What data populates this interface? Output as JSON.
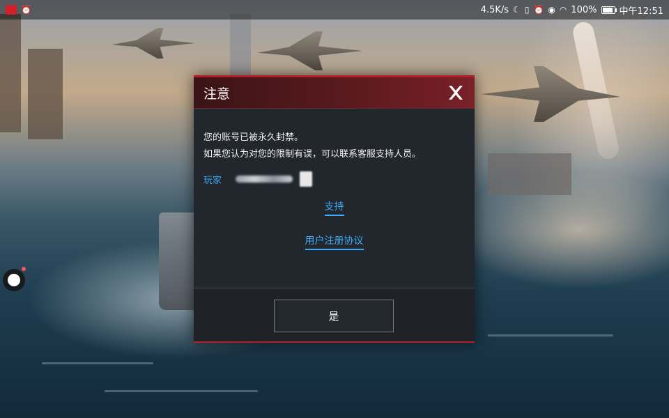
{
  "status_bar": {
    "net_speed": "4.5K/s",
    "battery": "100%",
    "battery_fraction": 1.0,
    "time": "中午12:51",
    "icons": [
      "app-icon",
      "alarm-icon",
      "moon-icon",
      "vibrate-icon",
      "alarm-icon",
      "eye-icon",
      "wifi-icon",
      "battery-icon"
    ]
  },
  "dialog": {
    "title": "注意",
    "message_line1": "您的账号已被永久封禁。",
    "message_line2": "如果您认为对您的限制有误，可以联系客服支持人员。",
    "player_label": "玩家",
    "support_link": "支持",
    "agreement_link": "用户注册协议",
    "confirm_button": "是"
  },
  "colors": {
    "accent_red": "#b3202a",
    "link_blue": "#3fa9f5",
    "dialog_bg": "#22272d"
  }
}
